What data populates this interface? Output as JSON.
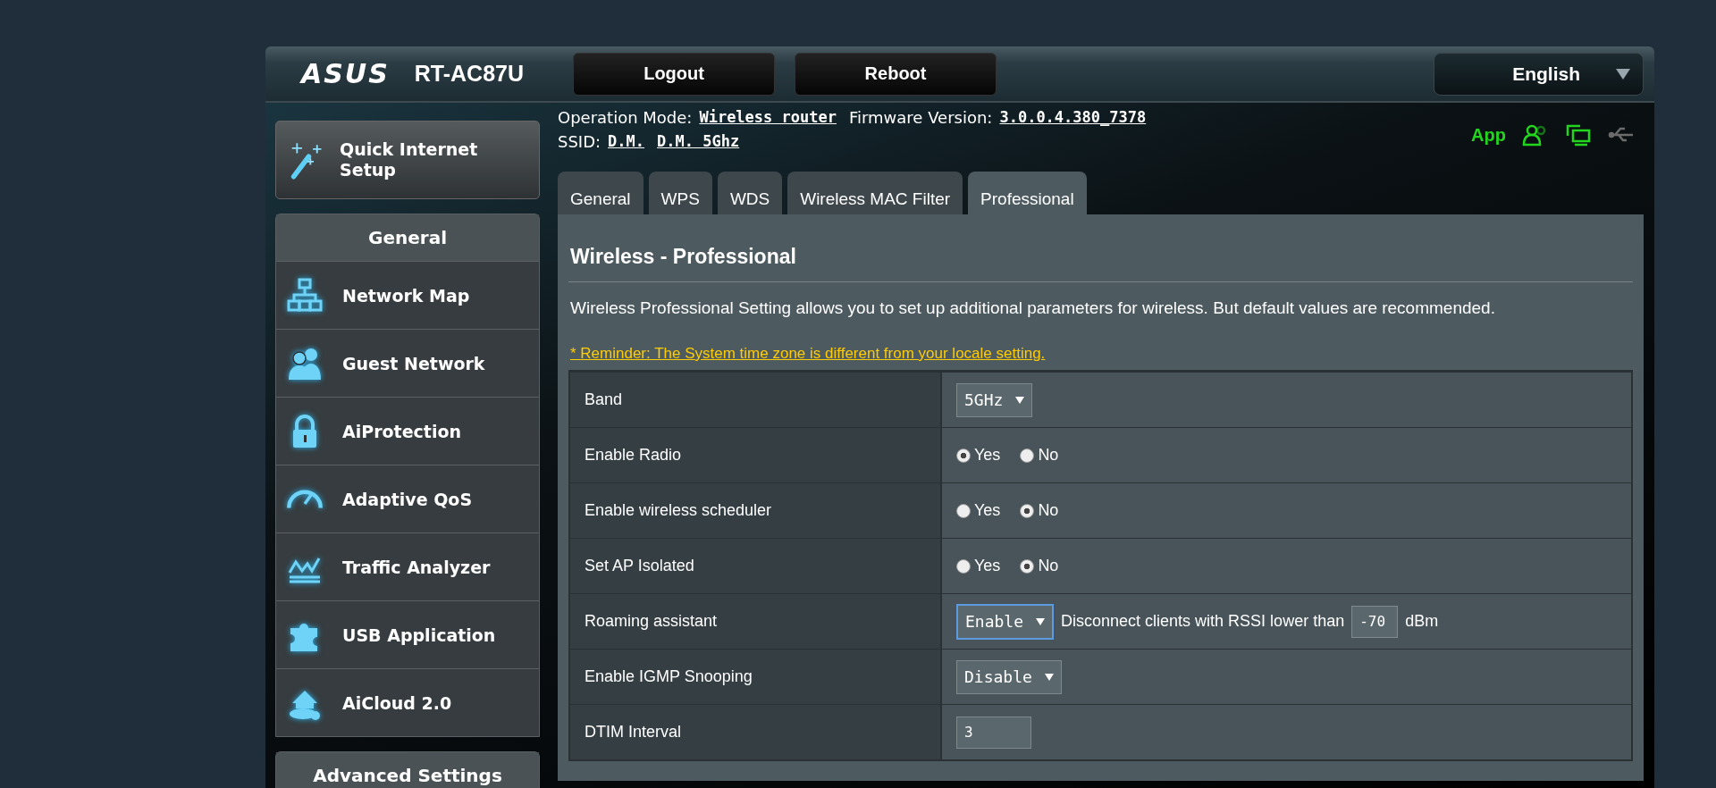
{
  "header": {
    "logo": "ASUS",
    "model": "RT-AC87U",
    "buttons": [
      "Logout",
      "Reboot"
    ],
    "language": "English"
  },
  "info": {
    "operation_mode_label": "Operation Mode:",
    "operation_mode": "Wireless router",
    "firmware_label": "Firmware Version:",
    "firmware": "3.0.0.4.380_7378",
    "ssid_label": "SSID:",
    "ssids": [
      "D.M.",
      "D.M. 5Ghz"
    ]
  },
  "status": {
    "app": "App",
    "icons": [
      {
        "kind": "clients",
        "active": true
      },
      {
        "kind": "devices",
        "active": true
      },
      {
        "kind": "usb",
        "active": false
      }
    ]
  },
  "sidebar": {
    "quick_setup": "Quick Internet Setup",
    "general_title": "General",
    "items": [
      {
        "label": "Network Map"
      },
      {
        "label": "Guest Network"
      },
      {
        "label": "AiProtection"
      },
      {
        "label": "Adaptive QoS"
      },
      {
        "label": "Traffic Analyzer"
      },
      {
        "label": "USB Application"
      },
      {
        "label": "AiCloud 2.0"
      }
    ],
    "advanced_title": "Advanced Settings"
  },
  "tabs": [
    {
      "label": "General",
      "selected": false
    },
    {
      "label": "WPS",
      "selected": false
    },
    {
      "label": "WDS",
      "selected": false
    },
    {
      "label": "Wireless MAC Filter",
      "selected": false
    },
    {
      "label": "Professional",
      "selected": true
    }
  ],
  "page": {
    "title": "Wireless - Professional",
    "description": "Wireless Professional Setting allows you to set up additional parameters for wireless. But default values are recommended.",
    "reminder": "* Reminder: The System time zone is different from your locale setting."
  },
  "settings": [
    {
      "kind": "select",
      "label": "Band",
      "value": "5GHz",
      "focused": false
    },
    {
      "kind": "radio",
      "label": "Enable Radio",
      "options": [
        {
          "label": "Yes",
          "selected": true
        },
        {
          "label": "No",
          "selected": false
        }
      ]
    },
    {
      "kind": "radio",
      "label": "Enable wireless scheduler",
      "options": [
        {
          "label": "Yes",
          "selected": false
        },
        {
          "label": "No",
          "selected": true
        }
      ]
    },
    {
      "kind": "radio",
      "label": "Set AP Isolated",
      "options": [
        {
          "label": "Yes",
          "selected": false
        },
        {
          "label": "No",
          "selected": true
        }
      ]
    },
    {
      "kind": "select_input",
      "label": "Roaming assistant",
      "value": "Enable",
      "focused": true,
      "text": "Disconnect clients with RSSI lower than",
      "input": "-70",
      "unit": "dBm"
    },
    {
      "kind": "select",
      "label": "Enable IGMP Snooping",
      "value": "Disable",
      "focused": false
    },
    {
      "kind": "text",
      "label": "DTIM Interval",
      "value": "3"
    }
  ]
}
